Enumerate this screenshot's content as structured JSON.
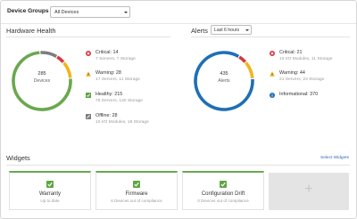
{
  "header": {
    "device_groups_label": "Device Groups",
    "device_groups_value": "All Devices"
  },
  "hardware_health": {
    "title": "Hardware Health",
    "total": "285",
    "total_label": "Devices",
    "items": [
      {
        "title": "Critical: 14",
        "subtitle": "7 Servers, 7 Storage",
        "icon": "critical-x-icon",
        "color": "#d9363e",
        "count": 14
      },
      {
        "title": "Warning: 28",
        "subtitle": "17 Servers, 11 Storage",
        "icon": "warning-triangle-icon",
        "color": "#f2b41c",
        "count": 28
      },
      {
        "title": "Healthy: 215",
        "subtitle": "75 Servers, 140 Storage",
        "icon": "healthy-check-icon",
        "color": "#6aa84f",
        "count": 215
      },
      {
        "title": "Offline: 28",
        "subtitle": "10 I/O Modules, 18 Storage",
        "icon": "offline-icon",
        "color": "#7d7d7d",
        "count": 28
      }
    ]
  },
  "alerts": {
    "title": "Alerts",
    "time_range": "Last 6 hours",
    "total": "435",
    "total_label": "Alerts",
    "items": [
      {
        "title": "Critical: 21",
        "subtitle": "10 I/O Modules, 11 Storage",
        "icon": "critical-x-icon",
        "color": "#d9363e",
        "count": 21
      },
      {
        "title": "Warning: 44",
        "subtitle": "21 Servers, 23 Storage",
        "icon": "warning-triangle-icon",
        "color": "#f2b41c",
        "count": 44
      },
      {
        "title": "Informational: 370",
        "subtitle": "",
        "icon": "info-icon",
        "color": "#1f6fb5",
        "count": 370
      }
    ]
  },
  "widgets": {
    "title": "Widgets",
    "select_link": "Select Widgets",
    "cards": [
      {
        "name": "Warranty",
        "status": "Up to date"
      },
      {
        "name": "Firmware",
        "status": "6 Devices out of compliance"
      },
      {
        "name": "Configuration Drift",
        "status": "0 Devices out of compliance"
      }
    ],
    "add_symbol": "+"
  }
}
